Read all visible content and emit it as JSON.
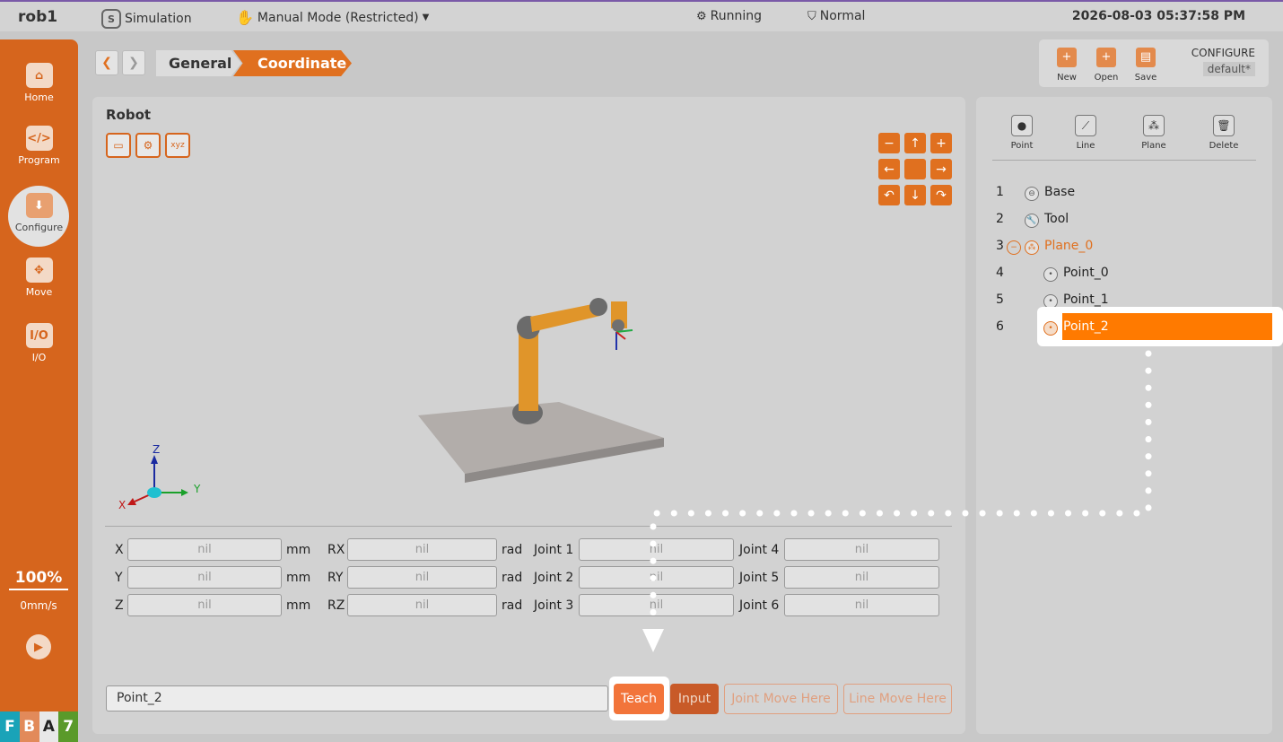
{
  "topbar": {
    "robot_name": "rob1",
    "simulation": "Simulation",
    "mode": "Manual Mode (Restricted)",
    "state": "Running",
    "safety": "Normal",
    "datetime": "2026-08-03 05:37:58 PM"
  },
  "sidebar": {
    "items": [
      {
        "label": "Home",
        "icon": "home-icon"
      },
      {
        "label": "Program",
        "icon": "code-icon"
      },
      {
        "label": "Configure",
        "icon": "configure-icon"
      },
      {
        "label": "Move",
        "icon": "move-arrows-icon"
      },
      {
        "label": "I/O",
        "icon": "io-icon"
      }
    ],
    "speed_percent": "100%",
    "speed_mms": "0mm/s",
    "badges": [
      "F",
      "B",
      "A",
      "7"
    ],
    "badge_colors": [
      "#1aa3b8",
      "#e28a5a",
      "#e8e8e8",
      "#5a9a2a"
    ]
  },
  "breadcrumb": {
    "items": [
      "General",
      "Coordinate"
    ]
  },
  "file_panel": {
    "new": "New",
    "open": "Open",
    "save": "Save",
    "config_title": "CONFIGURE",
    "config_name": "default*"
  },
  "robot_panel": {
    "title": "Robot",
    "axes": {
      "z": "Z",
      "x": "X",
      "y": "Y"
    },
    "fields": {
      "x_label": "X",
      "y_label": "Y",
      "z_label": "Z",
      "rx_label": "RX",
      "ry_label": "RY",
      "rz_label": "RZ",
      "unit_mm": "mm",
      "unit_rad": "rad",
      "joint_labels": [
        "Joint 1",
        "Joint 2",
        "Joint 3",
        "Joint 4",
        "Joint 5",
        "Joint 6"
      ],
      "value": "nil"
    },
    "name_value": "Point_2",
    "buttons": {
      "teach": "Teach",
      "input": "Input",
      "joint_move": "Joint Move Here",
      "line_move": "Line Move Here"
    }
  },
  "coord_panel": {
    "tools": [
      "Point",
      "Line",
      "Plane",
      "Delete"
    ],
    "tree": [
      {
        "num": "1",
        "label": "Base"
      },
      {
        "num": "2",
        "label": "Tool"
      },
      {
        "num": "3",
        "label": "Plane_0"
      },
      {
        "num": "4",
        "label": "Point_0"
      },
      {
        "num": "5",
        "label": "Point_1"
      },
      {
        "num": "6",
        "label": "Point_2"
      }
    ]
  },
  "colors": {
    "accent": "#e0701f",
    "sidebar": "#d6651d",
    "selected": "#ff7a00"
  }
}
